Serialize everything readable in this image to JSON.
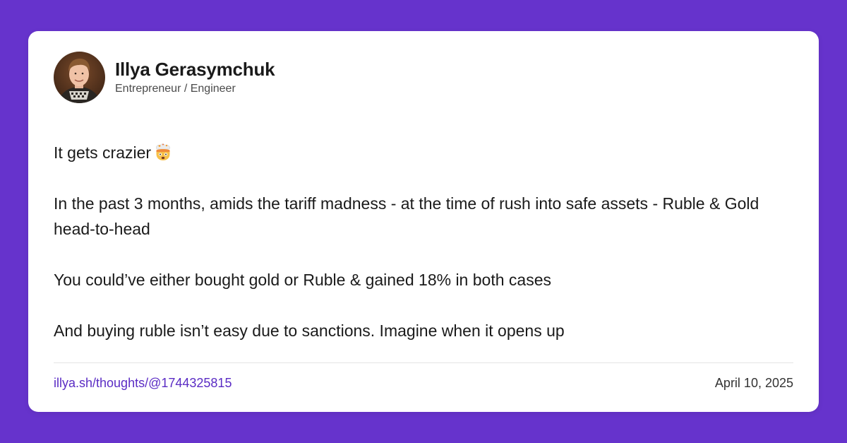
{
  "colors": {
    "background": "#6633cc",
    "card": "#ffffff",
    "link": "#5a2bc4",
    "text": "#1a1a1a"
  },
  "author": {
    "name": "Illya Gerasymchuk",
    "title": "Entrepreneur / Engineer",
    "avatar_icon": "profile-photo"
  },
  "post": {
    "paragraphs": [
      "It gets crazier",
      "In the past 3 months, amids the tariff madness - at the time of rush into safe assets - Ruble & Gold head-to-head",
      "You could’ve either bought gold or Ruble & gained 18% in both cases",
      "And buying ruble isn’t easy due to sanctions. Imagine when it opens up"
    ],
    "emoji_icon": "exploding-head-emoji"
  },
  "footer": {
    "link": "illya.sh/thoughts/@1744325815",
    "date": "April 10, 2025"
  }
}
